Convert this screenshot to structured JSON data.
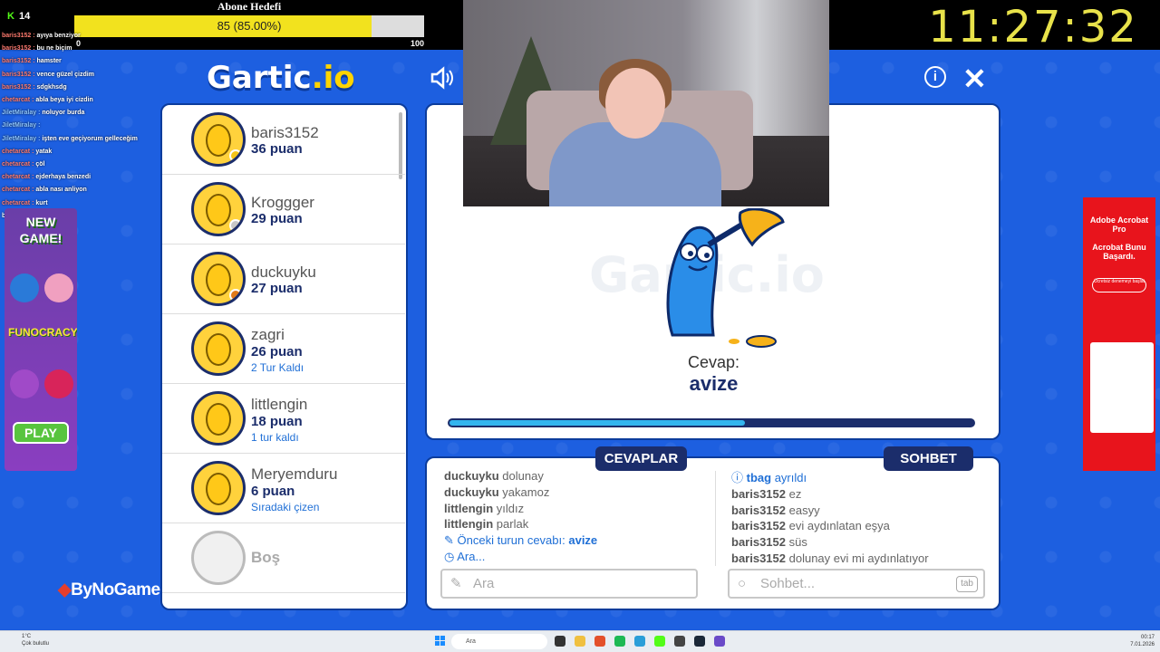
{
  "stream": {
    "kick_count": "14",
    "goal_title": "Abone Hedefi",
    "goal_text": "85 (85.00%)",
    "goal_progress": 0.85,
    "goal_min": "0",
    "goal_max": "100",
    "clock": "11:27:32",
    "chat": [
      {
        "user": "baris3152",
        "text": "ayıya benziyor",
        "cls": "u"
      },
      {
        "user": "baris3152",
        "text": "bu ne biçim",
        "cls": "u"
      },
      {
        "user": "baris3152",
        "text": "hamster",
        "cls": "u"
      },
      {
        "user": "baris3152",
        "text": "vence güzel çizdim",
        "cls": "u"
      },
      {
        "user": "baris3152",
        "text": "sdgkhsdg",
        "cls": "u"
      },
      {
        "user": "chetarcat",
        "text": "abla beya iyi cizdin",
        "cls": "u"
      },
      {
        "user": "JiletMiralay",
        "text": "noluyor burda",
        "cls": "u2"
      },
      {
        "user": "JiletMiralay",
        "text": "",
        "cls": "u2"
      },
      {
        "user": "JiletMiralay",
        "text": "işten eve geçiyorum gelleceğim",
        "cls": "u2"
      },
      {
        "user": "chetarcat",
        "text": "yatak",
        "cls": "u"
      },
      {
        "user": "chetarcat",
        "text": "çöl",
        "cls": "u"
      },
      {
        "user": "chetarcat",
        "text": "ejderhaya benzedi",
        "cls": "u"
      },
      {
        "user": "chetarcat",
        "text": "abla nası anliyon",
        "cls": "u"
      },
      {
        "user": "chetarcat",
        "text": "kurt",
        "cls": "u"
      },
      {
        "user": "",
        "text": "burda da yendim easy",
        "cls": "u"
      }
    ],
    "brand": "ByNoGame"
  },
  "game": {
    "logo_main": "Gartic",
    "logo_suffix": ".io",
    "watermark": "Gartic.io",
    "players": [
      {
        "name": "baris3152",
        "points": "36 puan",
        "note": "",
        "dot": "#f5c518"
      },
      {
        "name": "Kroggger",
        "points": "29 puan",
        "note": "",
        "dot": "#c7c7c7"
      },
      {
        "name": "duckuyku",
        "points": "27 puan",
        "note": "",
        "dot": "#e07b1a"
      },
      {
        "name": "zagri",
        "points": "26 puan",
        "note": "2 Tur Kaldı",
        "dot": ""
      },
      {
        "name": "littlengin",
        "points": "18 puan",
        "note": "1 tur kaldı",
        "dot": ""
      },
      {
        "name": "Meryemduru",
        "points": "6 puan",
        "note": "Sıradaki çizen",
        "dot": ""
      },
      {
        "name": "Boş",
        "points": "",
        "note": "",
        "dot": ""
      }
    ],
    "answer_label": "Cevap:",
    "answer_word": "avize",
    "round_progress": 0.56,
    "tabs": {
      "answers": "CEVAPLAR",
      "chat": "SOHBET"
    },
    "answers_log": [
      {
        "user": "duckuyku",
        "text": "dolunay"
      },
      {
        "user": "duckuyku",
        "text": "yakamoz"
      },
      {
        "user": "littlengin",
        "text": "yıldız"
      },
      {
        "user": "littlengin",
        "text": "parlak"
      }
    ],
    "prev_answer_label": "Önceki turun cevabı:",
    "prev_answer": "avize",
    "search_more": "Ara...",
    "chat_log": [
      {
        "user": "tbag",
        "text": "ayrıldı",
        "sys": true
      },
      {
        "user": "baris3152",
        "text": "ez"
      },
      {
        "user": "baris3152",
        "text": "easyy"
      },
      {
        "user": "baris3152",
        "text": "evi aydınlatan eşya"
      },
      {
        "user": "baris3152",
        "text": "süs"
      },
      {
        "user": "baris3152",
        "text": "dolunay evi mi aydınlatıyor"
      }
    ],
    "answer_placeholder": "Ara",
    "chat_placeholder": "Sohbet...",
    "tab_key": "tab"
  },
  "left_ad": {
    "title": "NEW GAME!",
    "brand": "FUNOCRACY",
    "play": "PLAY"
  },
  "right_ad": {
    "line1": "Adobe Acrobat Pro",
    "line2": "Acrobat Bunu Başardı.",
    "cta": "Ücretsiz denemeyi başlat"
  },
  "taskbar": {
    "weather_temp": "1°C",
    "weather_text": "Çok bulutlu",
    "search": "Ara",
    "time": "00:17",
    "date": "7.01.2026"
  }
}
